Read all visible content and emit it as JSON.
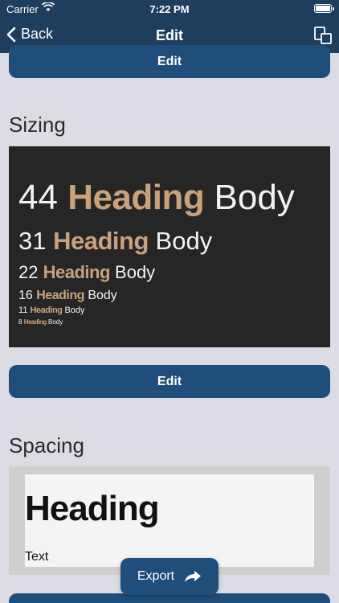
{
  "status": {
    "carrier": "Carrier",
    "time": "7:22 PM"
  },
  "nav": {
    "back_label": "Back",
    "title": "Edit"
  },
  "buttons": {
    "edit_top": "Edit",
    "edit_middle": "Edit",
    "export": "Export"
  },
  "sizing": {
    "title": "Sizing",
    "rows": [
      {
        "size": "44",
        "heading": "Heading",
        "body": "Body"
      },
      {
        "size": "31",
        "heading": "Heading",
        "body": "Body"
      },
      {
        "size": "22",
        "heading": "Heading",
        "body": "Body"
      },
      {
        "size": "16",
        "heading": "Heading",
        "body": "Body"
      },
      {
        "size": "11",
        "heading": "Heading",
        "body": "Body"
      },
      {
        "size": "8",
        "heading": "Heading",
        "body": "Body"
      }
    ]
  },
  "spacing": {
    "title": "Spacing",
    "heading": "Heading",
    "text": "Text"
  },
  "colors": {
    "nav": "#1f3d5c",
    "button": "#1f4e7b",
    "heading_accent": "#c9a27c",
    "panel_dark": "#262626"
  }
}
